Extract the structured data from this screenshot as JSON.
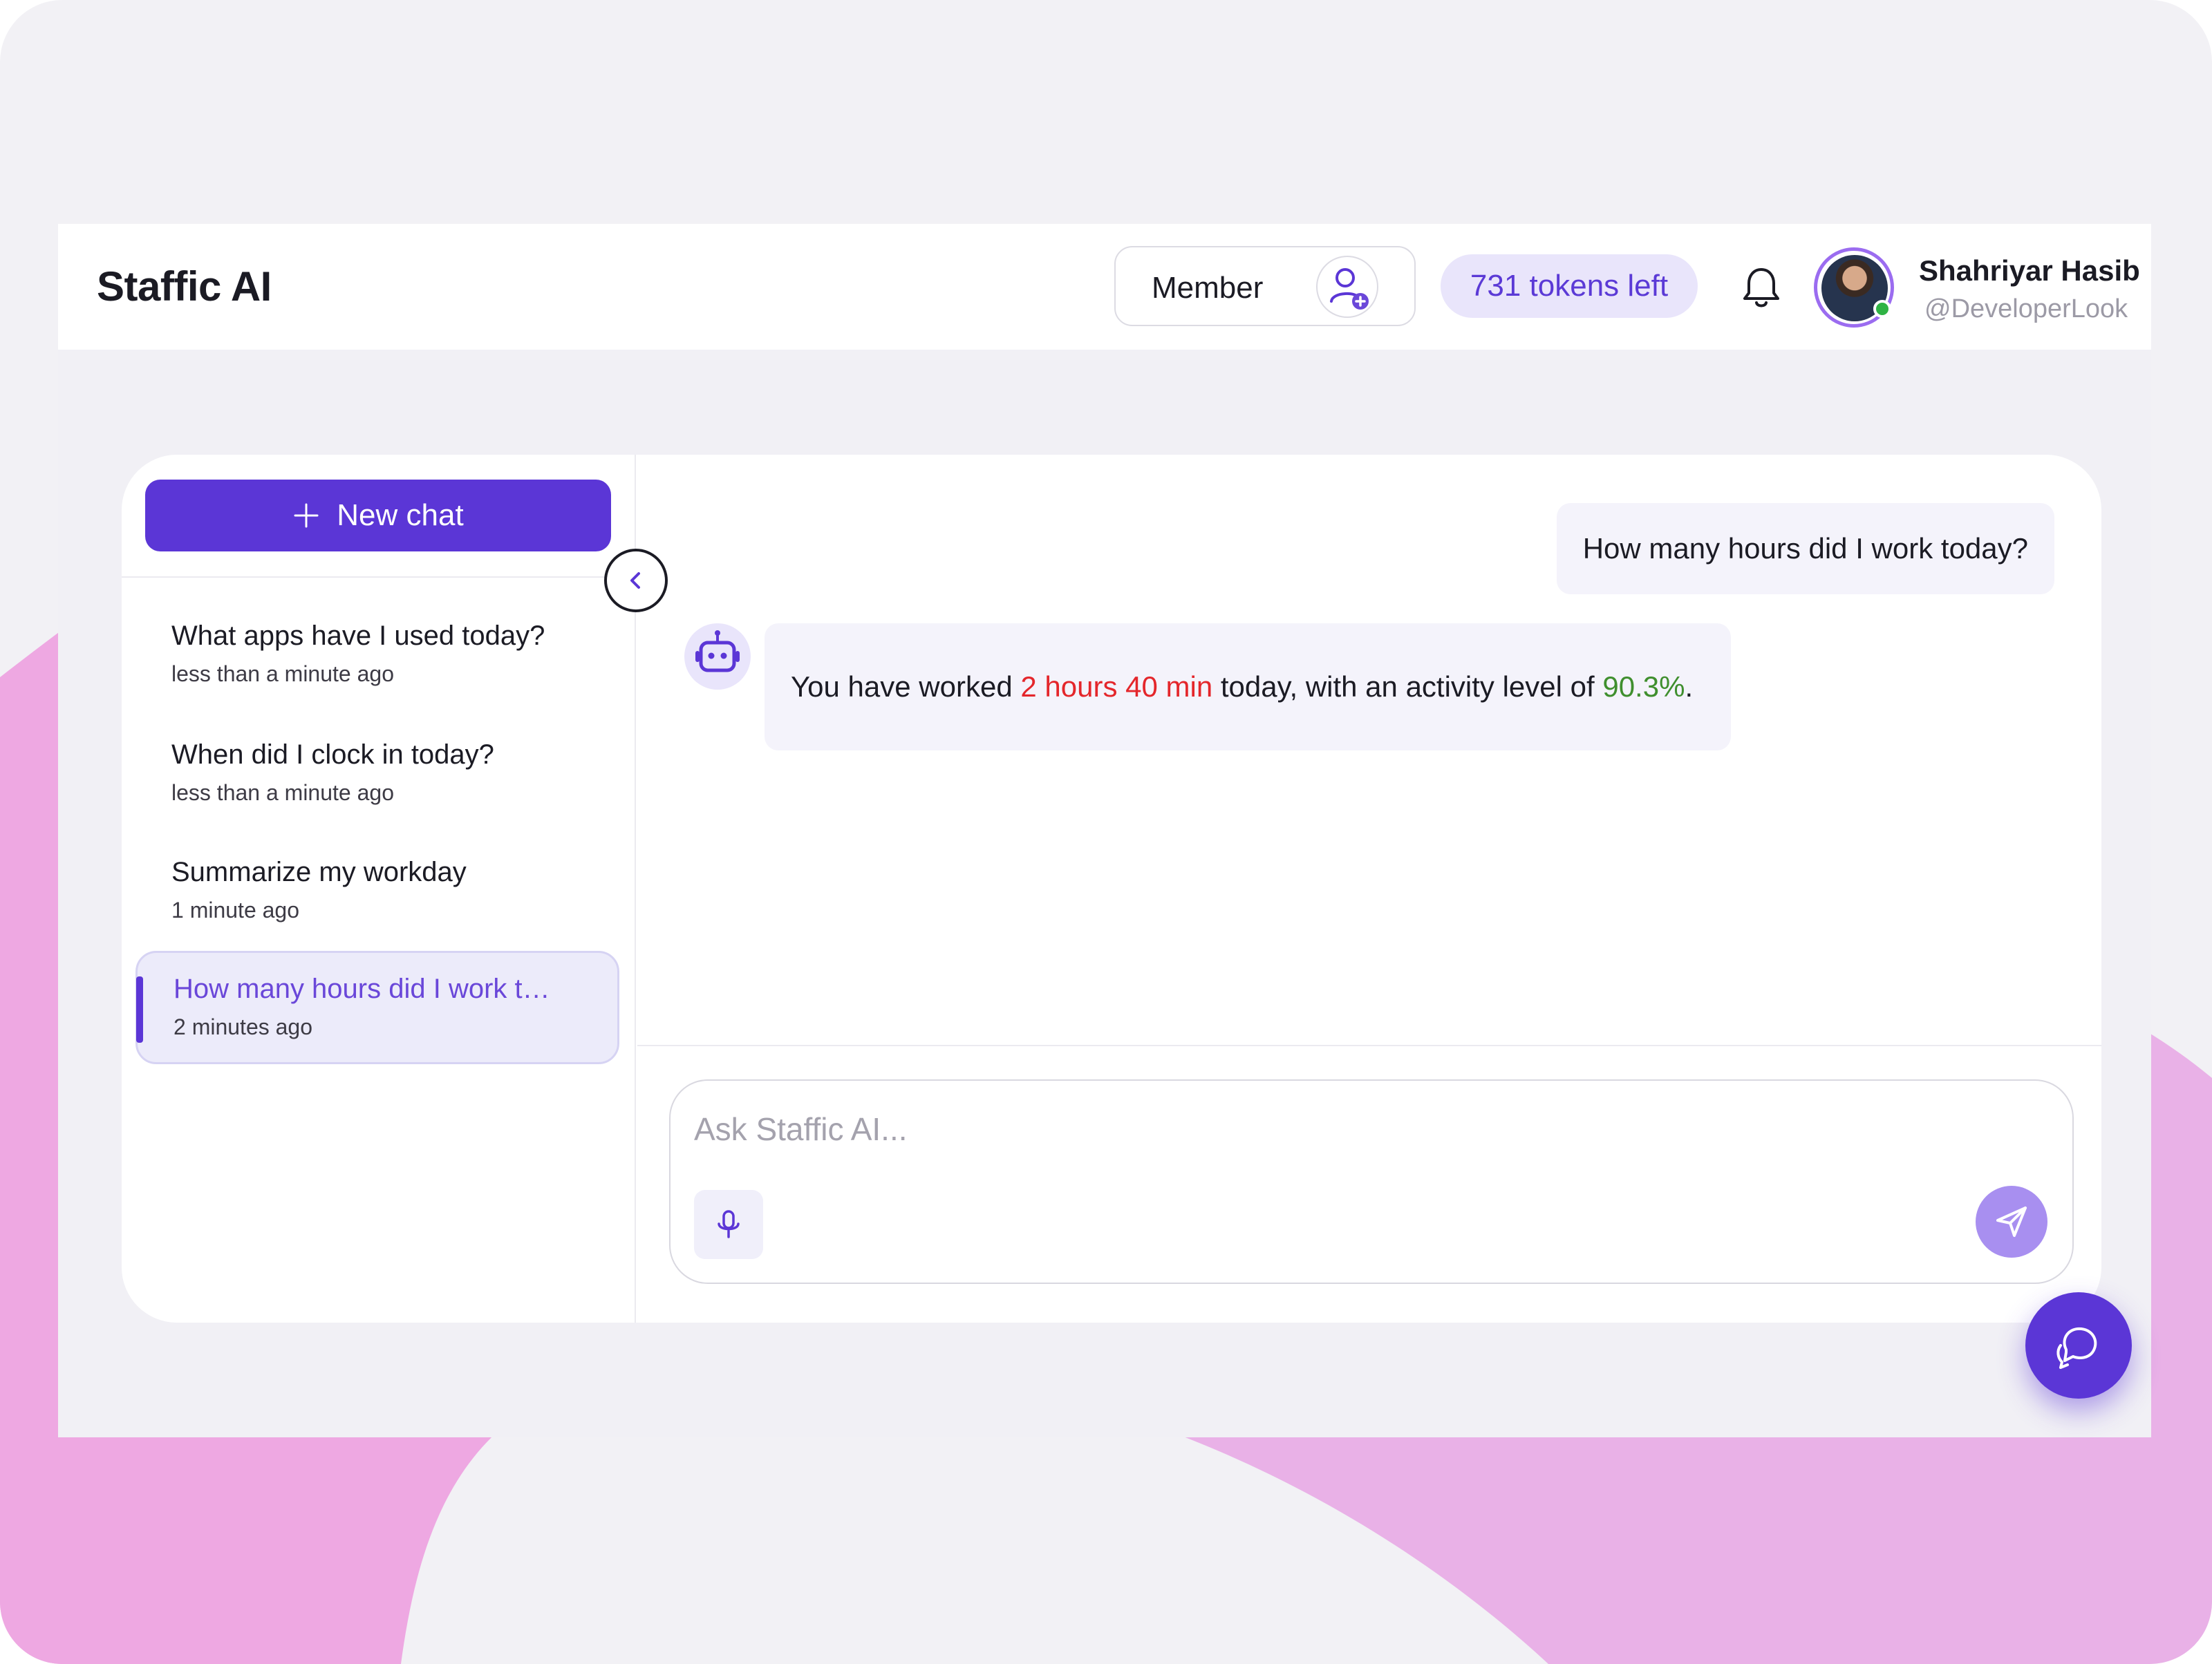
{
  "header": {
    "brand": "Staffic AI",
    "member_label": "Member",
    "member_icon": "add-user-icon",
    "tokens": "731 tokens left",
    "bell_icon": "bell-icon",
    "user_name": "Shahriyar Hasib",
    "user_handle": "@DeveloperLook",
    "online": true
  },
  "sidebar": {
    "new_chat_label": "New chat",
    "collapse_icon": "chevron-left-icon",
    "chats": [
      {
        "title": "What apps have I used today?",
        "time": "less than a minute ago",
        "active": false
      },
      {
        "title": "When did I clock in today?",
        "time": "less than a minute ago",
        "active": false
      },
      {
        "title": "Summarize my workday",
        "time": "1 minute ago",
        "active": false
      },
      {
        "title": "How many hours did I work to...",
        "time": "2 minutes ago",
        "active": true
      }
    ]
  },
  "conversation": {
    "user_message": "How many hours did I work today?",
    "bot_icon": "robot-icon",
    "bot_message": {
      "prefix": "You have worked ",
      "hours": "2 hours 40 min",
      "middle": " today, with an activity level of ",
      "activity": "90.3%",
      "suffix": "."
    }
  },
  "composer": {
    "placeholder": "Ask Staffic AI...",
    "mic_icon": "microphone-icon",
    "send_icon": "send-icon"
  },
  "fab": {
    "icon": "chat-bubbles-icon"
  },
  "colors": {
    "accent": "#5b36d6",
    "highlight_red": "#e4262b",
    "highlight_green": "#3f8f2e",
    "token_pill_bg": "#e9e5fb",
    "background_pink": "#eea8e2"
  }
}
